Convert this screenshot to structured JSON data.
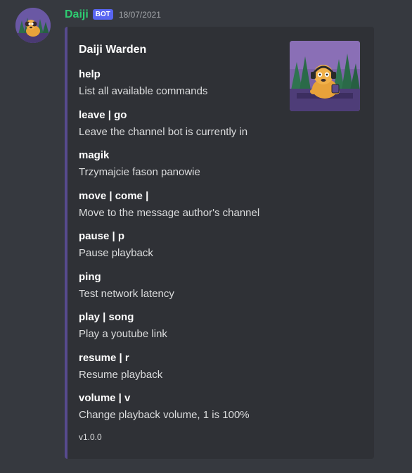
{
  "message": {
    "author": "Daiji",
    "bot_badge": "BOT",
    "timestamp": "18/07/2021"
  },
  "embed": {
    "accent_color": "#574a8e",
    "title": "Daiji Warden",
    "fields": [
      {
        "name": "help",
        "value": "List all available commands"
      },
      {
        "name": "leave | go",
        "value": "Leave the channel bot is currently in"
      },
      {
        "name": "magik",
        "value": "Trzymajcie fason panowie"
      },
      {
        "name": "move | come |",
        "value": "Move to the message author's channel"
      },
      {
        "name": "pause | p",
        "value": "Pause playback"
      },
      {
        "name": "ping",
        "value": "Test network latency"
      },
      {
        "name": "play | song",
        "value": "Play a youtube link"
      },
      {
        "name": "resume | r",
        "value": "Resume playback"
      },
      {
        "name": "volume | v",
        "value": "Change playback volume, 1 is 100%"
      }
    ],
    "footer": "v1.0.0"
  },
  "colors": {
    "background": "#36393f",
    "embed_background": "#2f3136",
    "username": "#2ecc71",
    "bot_badge": "#5865f2",
    "timestamp": "#a3a6aa"
  }
}
